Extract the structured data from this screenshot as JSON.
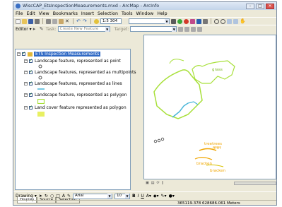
{
  "window": {
    "title": "WiscCAP_EtsInspectionMeasurements.mxd - ArcMap - ArcInfo"
  },
  "menu": [
    "File",
    "Edit",
    "View",
    "Bookmarks",
    "Insert",
    "Selection",
    "Tools",
    "Window",
    "Help"
  ],
  "standard_toolbar": {
    "scale": "1:5 304"
  },
  "editor_toolbar": {
    "editor_label": "Editor ▾",
    "task_label": "Task:",
    "task_value": "Create New Feature",
    "target_label": "Target:"
  },
  "toc": {
    "layer_group": "ETS Inspection Measurements",
    "layers": [
      "Landscape feature, represented as point",
      "Landscape features, represented as multipoints",
      "Landscape features, represented as lines",
      "Landscape feature, represented as polygon",
      "Land cover feature represented as polygon"
    ],
    "tabs": [
      "Display",
      "Source",
      "Selection"
    ]
  },
  "map": {
    "labels": [
      "grass",
      "treetrees",
      "ffffff",
      "bracken",
      "bracken"
    ]
  },
  "drawing_toolbar": {
    "drawing_label": "Drawing ▾",
    "font": "Arial",
    "font_size": "10",
    "bold": "B",
    "italic": "I",
    "underline": "U"
  },
  "status": {
    "coordinates": "365119.378  628686.061 Meters"
  },
  "colors": {
    "polygon_outline": "#a8e03a",
    "line": "#49b6d8",
    "label_orange": "#f0a500",
    "selection": "#316ac5"
  }
}
